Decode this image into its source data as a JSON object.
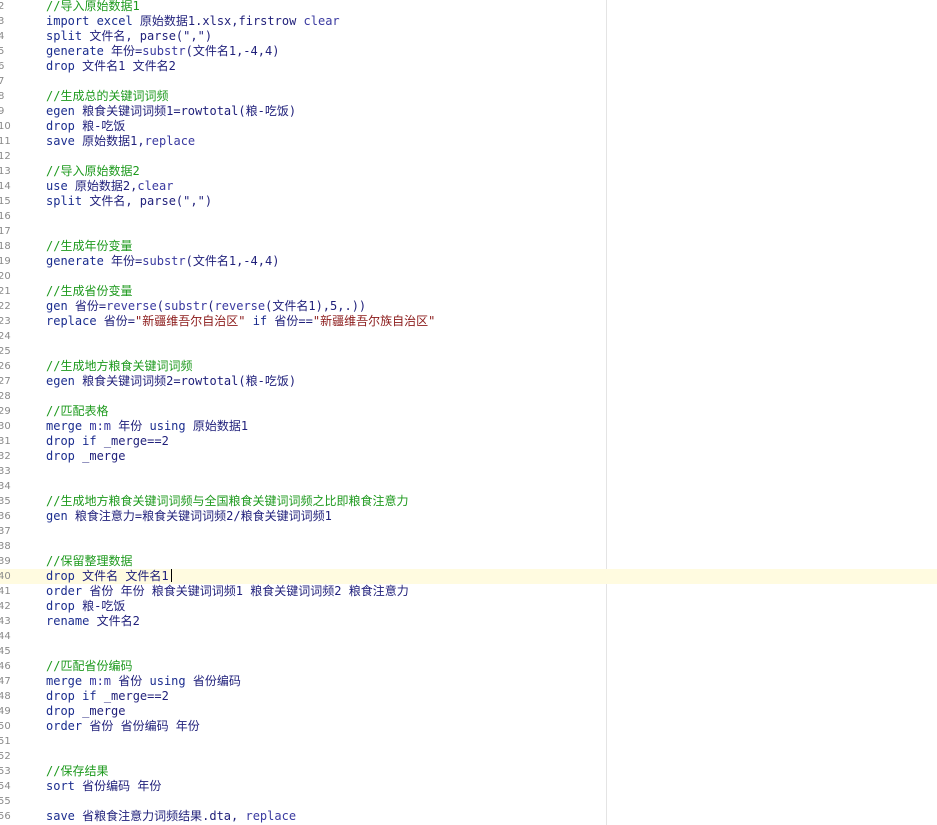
{
  "editor": {
    "current_line": 40,
    "lines": [
      {
        "n": "2",
        "tokens": [
          {
            "t": "//导入原始数据1",
            "c": "comment"
          }
        ]
      },
      {
        "n": "3",
        "tokens": [
          {
            "t": "import excel ",
            "c": "keyword"
          },
          {
            "t": "原始数据1.xlsx,firstrow ",
            "c": "plain"
          },
          {
            "t": "clear",
            "c": "func"
          }
        ]
      },
      {
        "n": "4",
        "tokens": [
          {
            "t": "split ",
            "c": "keyword"
          },
          {
            "t": "文件名, parse(\",\")",
            "c": "plain"
          }
        ]
      },
      {
        "n": "5",
        "tokens": [
          {
            "t": "generate ",
            "c": "keyword"
          },
          {
            "t": "年份=",
            "c": "plain"
          },
          {
            "t": "substr",
            "c": "func"
          },
          {
            "t": "(文件名1,-4,4)",
            "c": "plain"
          }
        ]
      },
      {
        "n": "6",
        "tokens": [
          {
            "t": "drop ",
            "c": "keyword"
          },
          {
            "t": "文件名1 文件名2",
            "c": "plain"
          }
        ]
      },
      {
        "n": "7",
        "tokens": []
      },
      {
        "n": "8",
        "tokens": [
          {
            "t": "//生成总的关键词词频",
            "c": "comment"
          }
        ]
      },
      {
        "n": "9",
        "tokens": [
          {
            "t": "egen ",
            "c": "keyword"
          },
          {
            "t": "粮食关键词词频1=rowtotal(粮-吃饭)",
            "c": "plain"
          }
        ]
      },
      {
        "n": "10",
        "tokens": [
          {
            "t": "drop ",
            "c": "keyword"
          },
          {
            "t": "粮-吃饭",
            "c": "plain"
          }
        ]
      },
      {
        "n": "11",
        "tokens": [
          {
            "t": "save ",
            "c": "keyword"
          },
          {
            "t": "原始数据1,",
            "c": "plain"
          },
          {
            "t": "replace",
            "c": "func"
          }
        ]
      },
      {
        "n": "12",
        "tokens": []
      },
      {
        "n": "13",
        "tokens": [
          {
            "t": "//导入原始数据2",
            "c": "comment"
          }
        ]
      },
      {
        "n": "14",
        "tokens": [
          {
            "t": "use ",
            "c": "keyword"
          },
          {
            "t": "原始数据2,",
            "c": "plain"
          },
          {
            "t": "clear",
            "c": "func"
          }
        ]
      },
      {
        "n": "15",
        "tokens": [
          {
            "t": "split ",
            "c": "keyword"
          },
          {
            "t": "文件名, parse(\",\")",
            "c": "plain"
          }
        ]
      },
      {
        "n": "16",
        "tokens": []
      },
      {
        "n": "17",
        "tokens": []
      },
      {
        "n": "18",
        "tokens": [
          {
            "t": "//生成年份变量",
            "c": "comment"
          }
        ]
      },
      {
        "n": "19",
        "tokens": [
          {
            "t": "generate ",
            "c": "keyword"
          },
          {
            "t": "年份=",
            "c": "plain"
          },
          {
            "t": "substr",
            "c": "func"
          },
          {
            "t": "(文件名1,-4,4)",
            "c": "plain"
          }
        ]
      },
      {
        "n": "20",
        "tokens": []
      },
      {
        "n": "21",
        "tokens": [
          {
            "t": "//生成省份变量",
            "c": "comment"
          }
        ]
      },
      {
        "n": "22",
        "tokens": [
          {
            "t": "gen ",
            "c": "keyword"
          },
          {
            "t": "省份=",
            "c": "plain"
          },
          {
            "t": "reverse",
            "c": "func"
          },
          {
            "t": "(",
            "c": "plain"
          },
          {
            "t": "substr",
            "c": "func"
          },
          {
            "t": "(",
            "c": "plain"
          },
          {
            "t": "reverse",
            "c": "func"
          },
          {
            "t": "(文件名1),5,.))",
            "c": "plain"
          }
        ]
      },
      {
        "n": "23",
        "tokens": [
          {
            "t": "replace ",
            "c": "keyword"
          },
          {
            "t": "省份=",
            "c": "plain"
          },
          {
            "t": "\"新疆维吾尔自治区\"",
            "c": "string"
          },
          {
            "t": " if ",
            "c": "keyword"
          },
          {
            "t": "省份==",
            "c": "plain"
          },
          {
            "t": "\"新疆维吾尔族自治区\"",
            "c": "string"
          }
        ]
      },
      {
        "n": "24",
        "tokens": []
      },
      {
        "n": "25",
        "tokens": []
      },
      {
        "n": "26",
        "tokens": [
          {
            "t": "//生成地方粮食关键词词频",
            "c": "comment"
          }
        ]
      },
      {
        "n": "27",
        "tokens": [
          {
            "t": "egen ",
            "c": "keyword"
          },
          {
            "t": "粮食关键词词频2=rowtotal(粮-吃饭)",
            "c": "plain"
          }
        ]
      },
      {
        "n": "28",
        "tokens": []
      },
      {
        "n": "29",
        "tokens": [
          {
            "t": "//匹配表格",
            "c": "comment"
          }
        ]
      },
      {
        "n": "30",
        "tokens": [
          {
            "t": "merge ",
            "c": "keyword"
          },
          {
            "t": "m:m ",
            "c": "func"
          },
          {
            "t": "年份 ",
            "c": "plain"
          },
          {
            "t": "using ",
            "c": "keyword"
          },
          {
            "t": "原始数据1",
            "c": "plain"
          }
        ]
      },
      {
        "n": "31",
        "tokens": [
          {
            "t": "drop ",
            "c": "keyword"
          },
          {
            "t": "if ",
            "c": "keyword"
          },
          {
            "t": "_merge==2",
            "c": "plain"
          }
        ]
      },
      {
        "n": "32",
        "tokens": [
          {
            "t": "drop ",
            "c": "keyword"
          },
          {
            "t": "_merge",
            "c": "plain"
          }
        ]
      },
      {
        "n": "33",
        "tokens": []
      },
      {
        "n": "34",
        "tokens": []
      },
      {
        "n": "35",
        "tokens": [
          {
            "t": "//生成地方粮食关键词词频与全国粮食关键词词频之比即粮食注意力",
            "c": "comment"
          }
        ]
      },
      {
        "n": "36",
        "tokens": [
          {
            "t": "gen ",
            "c": "keyword"
          },
          {
            "t": "粮食注意力=粮食关键词词频2/粮食关键词词频1",
            "c": "plain"
          }
        ]
      },
      {
        "n": "37",
        "tokens": []
      },
      {
        "n": "38",
        "tokens": []
      },
      {
        "n": "39",
        "tokens": [
          {
            "t": "//保留整理数据",
            "c": "comment"
          }
        ]
      },
      {
        "n": "40",
        "tokens": [
          {
            "t": "drop ",
            "c": "keyword"
          },
          {
            "t": "文件名 文件名1",
            "c": "plain"
          }
        ]
      },
      {
        "n": "41",
        "tokens": [
          {
            "t": "order ",
            "c": "keyword"
          },
          {
            "t": "省份 年份 粮食关键词词频1 粮食关键词词频2 粮食注意力",
            "c": "plain"
          }
        ]
      },
      {
        "n": "42",
        "tokens": [
          {
            "t": "drop ",
            "c": "keyword"
          },
          {
            "t": "粮-吃饭",
            "c": "plain"
          }
        ]
      },
      {
        "n": "43",
        "tokens": [
          {
            "t": "rename ",
            "c": "keyword"
          },
          {
            "t": "文件名2",
            "c": "plain"
          }
        ]
      },
      {
        "n": "44",
        "tokens": []
      },
      {
        "n": "45",
        "tokens": []
      },
      {
        "n": "46",
        "tokens": [
          {
            "t": "//匹配省份编码",
            "c": "comment"
          }
        ]
      },
      {
        "n": "47",
        "tokens": [
          {
            "t": "merge ",
            "c": "keyword"
          },
          {
            "t": "m:m ",
            "c": "func"
          },
          {
            "t": "省份 ",
            "c": "plain"
          },
          {
            "t": "using ",
            "c": "keyword"
          },
          {
            "t": "省份编码",
            "c": "plain"
          }
        ]
      },
      {
        "n": "48",
        "tokens": [
          {
            "t": "drop ",
            "c": "keyword"
          },
          {
            "t": "if ",
            "c": "keyword"
          },
          {
            "t": "_merge==2",
            "c": "plain"
          }
        ]
      },
      {
        "n": "49",
        "tokens": [
          {
            "t": "drop ",
            "c": "keyword"
          },
          {
            "t": "_merge",
            "c": "plain"
          }
        ]
      },
      {
        "n": "50",
        "tokens": [
          {
            "t": "order ",
            "c": "keyword"
          },
          {
            "t": "省份 省份编码 年份",
            "c": "plain"
          }
        ]
      },
      {
        "n": "51",
        "tokens": []
      },
      {
        "n": "52",
        "tokens": []
      },
      {
        "n": "53",
        "tokens": [
          {
            "t": "//保存结果",
            "c": "comment"
          }
        ]
      },
      {
        "n": "54",
        "tokens": [
          {
            "t": "sort ",
            "c": "keyword"
          },
          {
            "t": "省份编码 年份",
            "c": "plain"
          }
        ]
      },
      {
        "n": "55",
        "tokens": []
      },
      {
        "n": "56",
        "tokens": [
          {
            "t": "save ",
            "c": "keyword"
          },
          {
            "t": "省粮食注意力词频结果.dta, ",
            "c": "plain"
          },
          {
            "t": "replace",
            "c": "func"
          }
        ]
      }
    ]
  }
}
